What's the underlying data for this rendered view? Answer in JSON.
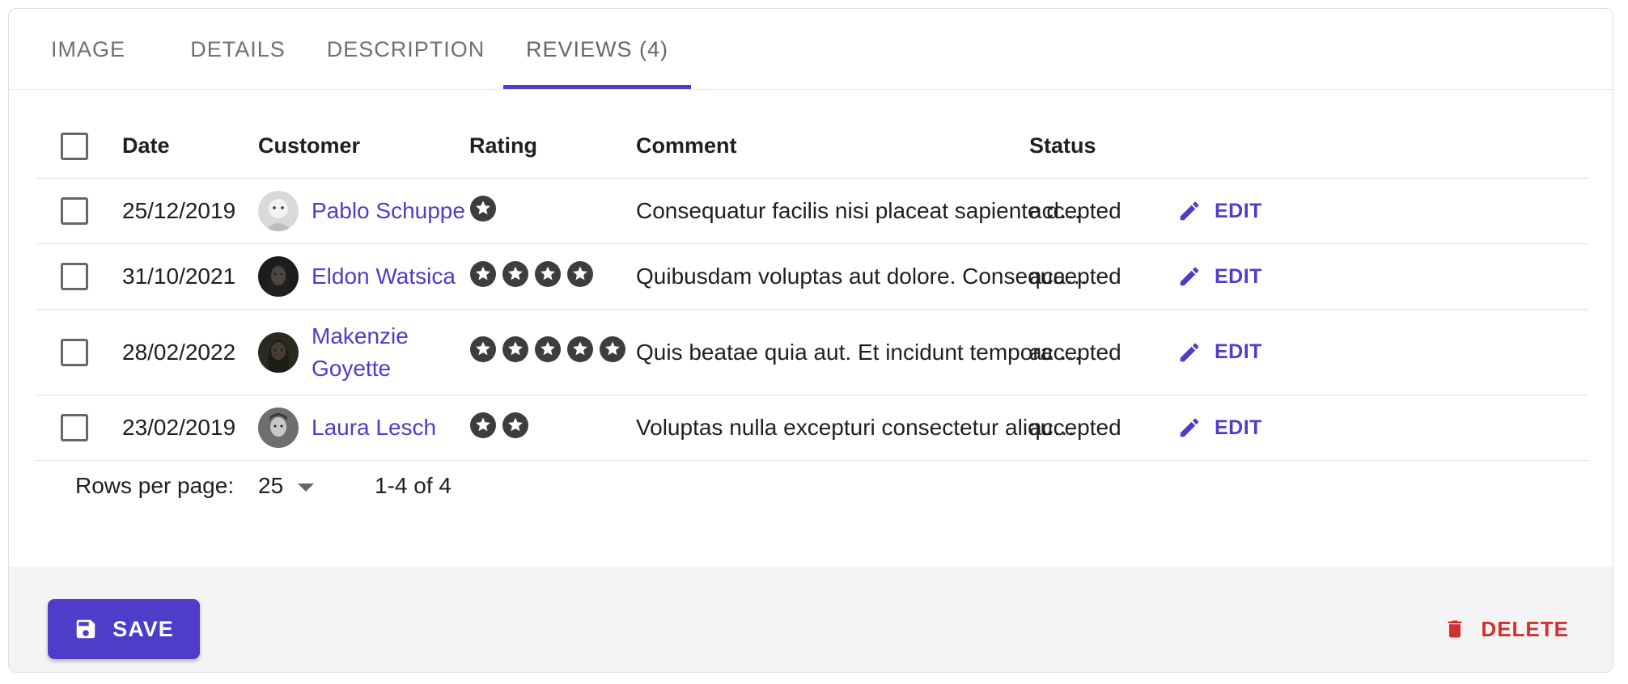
{
  "tabs": [
    {
      "label": "IMAGE"
    },
    {
      "label": "DETAILS"
    },
    {
      "label": "DESCRIPTION"
    },
    {
      "label": "REVIEWS (4)"
    }
  ],
  "active_tab": "REVIEWS (4)",
  "table": {
    "headers": {
      "date": "Date",
      "customer": "Customer",
      "rating": "Rating",
      "comment": "Comment",
      "status": "Status"
    },
    "rows": [
      {
        "date": "25/12/2019",
        "customer": "Pablo Schuppe",
        "customer_line2": "",
        "rating": 1,
        "comment": "Consequatur facilis nisi placeat sapiente d…",
        "status": "accepted",
        "edit": "EDIT"
      },
      {
        "date": "31/10/2021",
        "customer": "Eldon Watsica",
        "customer_line2": "",
        "rating": 4,
        "comment": "Quibusdam voluptas aut dolore. Consequa…",
        "status": "accepted",
        "edit": "EDIT"
      },
      {
        "date": "28/02/2022",
        "customer": "Makenzie",
        "customer_line2": "Goyette",
        "rating": 5,
        "comment": "Quis beatae quia aut. Et incidunt tempora …",
        "status": "accepted",
        "edit": "EDIT"
      },
      {
        "date": "23/02/2019",
        "customer": "Laura Lesch",
        "customer_line2": "",
        "rating": 2,
        "comment": "Voluptas nulla excepturi consectetur aliqu…",
        "status": "accepted",
        "edit": "EDIT"
      }
    ]
  },
  "pagination": {
    "rows_per_page_label": "Rows per page:",
    "rows_per_page": "25",
    "range": "1-4 of 4"
  },
  "toolbar": {
    "save_label": "SAVE",
    "delete_label": "DELETE"
  },
  "colors": {
    "primary": "#4f3cc9",
    "danger": "#d32f2f",
    "toolbar_bg": "#f4f4f4"
  },
  "icons": {
    "edit": "pencil-icon",
    "save": "floppy-disk-icon",
    "delete": "trash-icon",
    "rating": "star-icon",
    "sort": "caret-down-icon"
  }
}
